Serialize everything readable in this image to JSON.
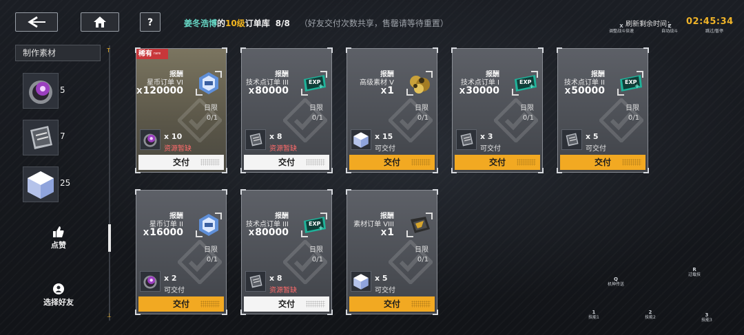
{
  "header": {
    "back_icon": "back-arrow-icon",
    "home_icon": "home-icon",
    "help_icon": "question-mark-icon",
    "title_name": "姜冬浩博",
    "title_of": "的",
    "title_level": "10级",
    "title_suffix": "订单库",
    "title_count": "8/8",
    "title_note": "（好友交付次数共享，售罄请等待重置）",
    "refresh_label": "刷新剩余时间：",
    "refresh_time": "02:45:34",
    "hotkeys_top": [
      {
        "key": "X",
        "label": "调整战斗倍速"
      },
      {
        "key": "Z",
        "label": "自动战斗"
      },
      {
        "key": "",
        "label": "跳过/暂停"
      }
    ],
    "hotkeys_bottom": [
      {
        "key": "Q",
        "label": "机神传送"
      },
      {
        "key": "R",
        "label": "过载技"
      },
      {
        "key": "1",
        "label": "技能1"
      },
      {
        "key": "2",
        "label": "技能2"
      },
      {
        "key": "3",
        "label": "技能3"
      }
    ]
  },
  "sidebar": {
    "title": "制作素材",
    "scroll_top_mark": "T",
    "scroll_bottom_mark": "⊥",
    "materials": [
      {
        "icon": "purple-orb-icon",
        "count": "5"
      },
      {
        "icon": "metal-plate-icon",
        "count": "7"
      },
      {
        "icon": "crystal-cube-icon",
        "count": "25"
      }
    ],
    "like_icon": "thumbs-up-icon",
    "like_label": "点赞",
    "friend_icon": "friend-select-icon",
    "friend_label": "选择好友"
  },
  "orders": [
    {
      "rare": true,
      "rare_label": "稀有",
      "rare_sub": "rare",
      "reward_label": "报酬",
      "reward_name": "星币订单 VI",
      "reward_qty": "120000",
      "reward_icon": "star-coin-icon",
      "limit_label": "日限",
      "limit_value": "0/1",
      "req_icon": "purple-orb-icon",
      "req_qty": "x 10",
      "req_status": "资源暂缺",
      "req_ok": false,
      "deliver_label": "交付",
      "deliver_active": false
    },
    {
      "rare": false,
      "reward_label": "报酬",
      "reward_name": "技术点订单 III",
      "reward_qty": "80000",
      "reward_icon": "exp-ticket-icon",
      "limit_label": "日限",
      "limit_value": "0/1",
      "req_icon": "metal-plate-icon",
      "req_qty": "x 8",
      "req_status": "资源暂缺",
      "req_ok": false,
      "deliver_label": "交付",
      "deliver_active": false
    },
    {
      "rare": false,
      "reward_label": "报酬",
      "reward_name": "高级素材 V",
      "reward_qty": "1",
      "reward_icon": "gold-ore-icon",
      "limit_label": "日限",
      "limit_value": "0/1",
      "req_icon": "crystal-cube-icon",
      "req_qty": "x 15",
      "req_status": "可交付",
      "req_ok": true,
      "deliver_label": "交付",
      "deliver_active": true
    },
    {
      "rare": false,
      "reward_label": "报酬",
      "reward_name": "技术点订单 I",
      "reward_qty": "30000",
      "reward_icon": "exp-ticket-icon",
      "limit_label": "日限",
      "limit_value": "0/1",
      "req_icon": "metal-plate-icon",
      "req_qty": "x 3",
      "req_status": "可交付",
      "req_ok": true,
      "deliver_label": "交付",
      "deliver_active": true
    },
    {
      "rare": false,
      "reward_label": "报酬",
      "reward_name": "技术点订单 II",
      "reward_qty": "50000",
      "reward_icon": "exp-ticket-icon",
      "limit_label": "日限",
      "limit_value": "0/1",
      "req_icon": "metal-plate-icon",
      "req_qty": "x 5",
      "req_status": "可交付",
      "req_ok": true,
      "deliver_label": "交付",
      "deliver_active": true
    },
    {
      "rare": false,
      "reward_label": "报酬",
      "reward_name": "星币订单 II",
      "reward_qty": "16000",
      "reward_icon": "star-coin-icon",
      "limit_label": "日限",
      "limit_value": "0/1",
      "req_icon": "purple-orb-icon",
      "req_qty": "x 2",
      "req_status": "可交付",
      "req_ok": true,
      "deliver_label": "交付",
      "deliver_active": true
    },
    {
      "rare": false,
      "reward_label": "报酬",
      "reward_name": "技术点订单 III",
      "reward_qty": "80000",
      "reward_icon": "exp-ticket-icon",
      "limit_label": "日限",
      "limit_value": "0/1",
      "req_icon": "metal-plate-icon",
      "req_qty": "x 8",
      "req_status": "资源暂缺",
      "req_ok": false,
      "deliver_label": "交付",
      "deliver_active": false
    },
    {
      "rare": false,
      "reward_label": "报酬",
      "reward_name": "素材订单 VIII",
      "reward_qty": "1",
      "reward_icon": "material-crate-icon",
      "limit_label": "日限",
      "limit_value": "0/1",
      "req_icon": "crystal-cube-icon",
      "req_qty": "x 5",
      "req_status": "可交付",
      "req_ok": true,
      "deliver_label": "交付",
      "deliver_active": true
    }
  ],
  "colors": {
    "accent": "#f2a922",
    "name": "#67d8c6",
    "level": "#f2b51f",
    "shortage": "#ff6b6b",
    "rare": "#c8373a"
  }
}
